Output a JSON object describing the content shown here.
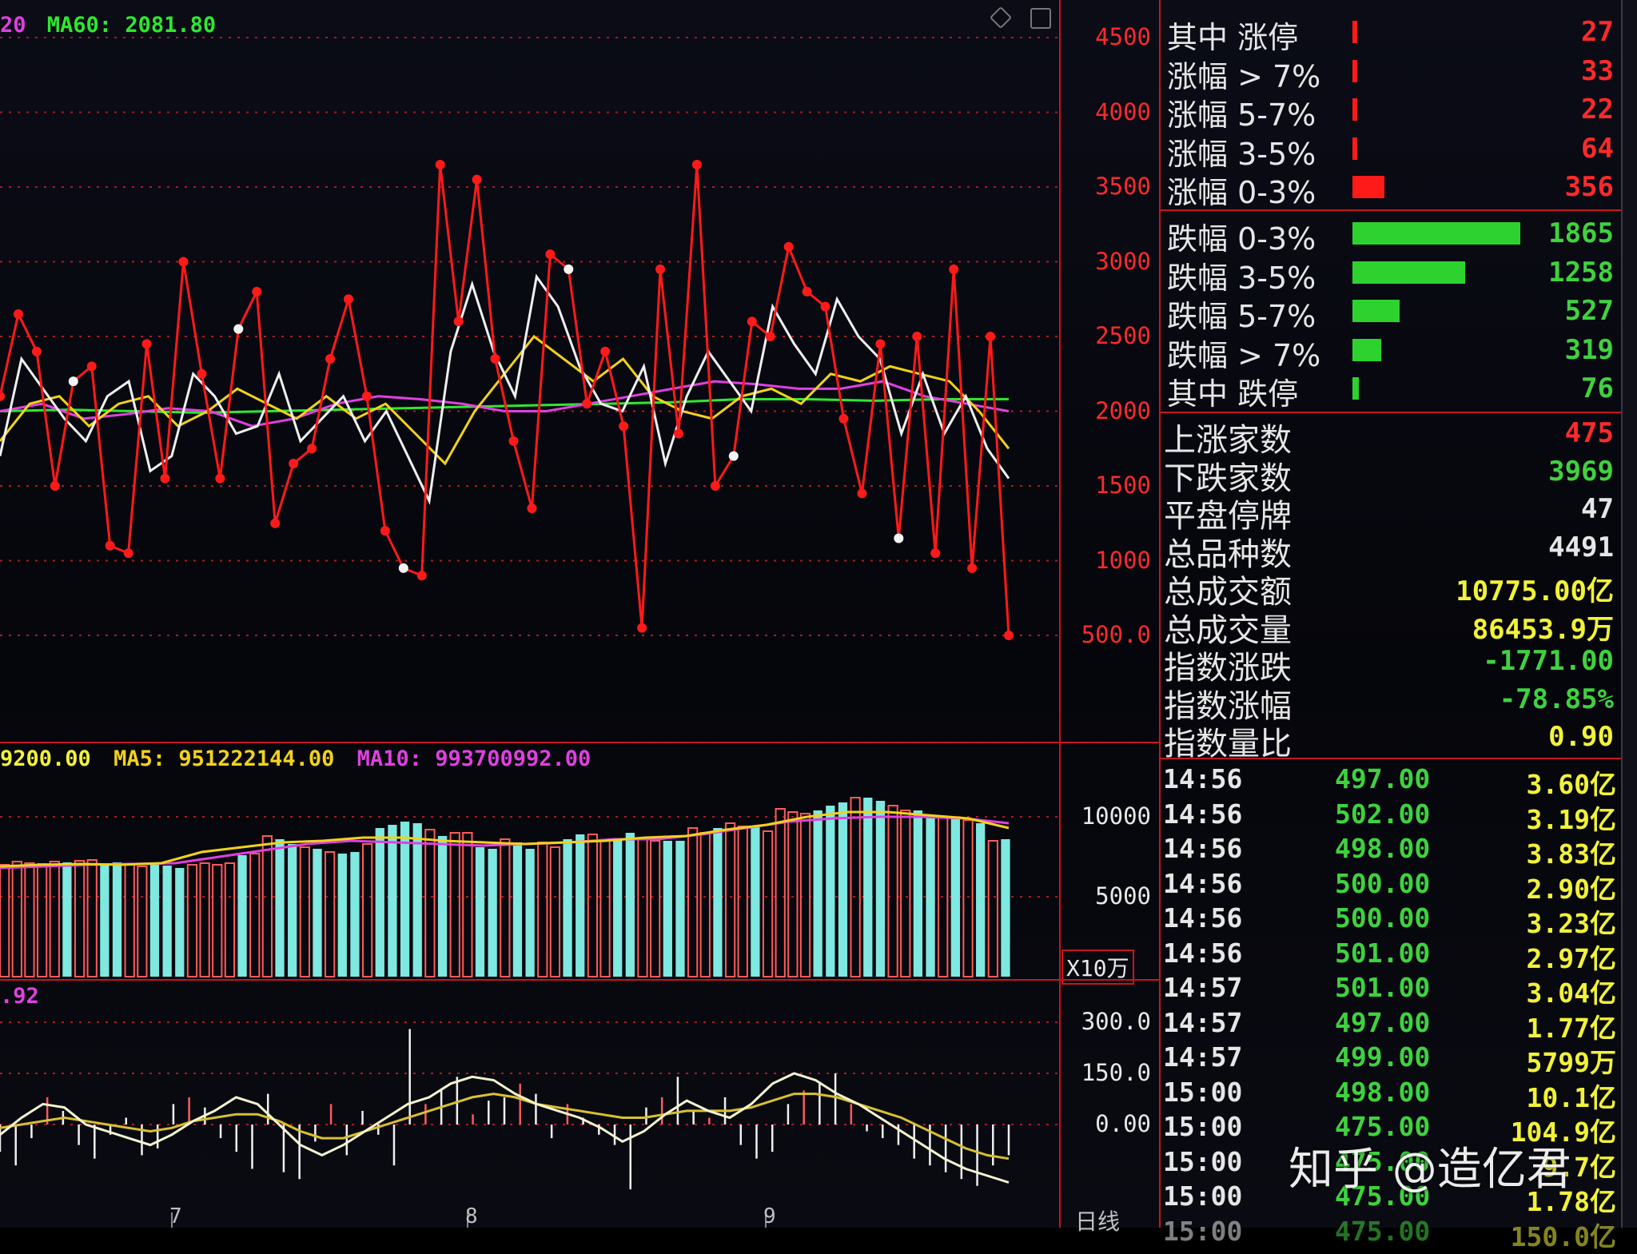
{
  "main_chart": {
    "legend": {
      "ma20_partial": "20",
      "ma60": "MA60: 2081.80"
    },
    "y_axis_labels": [
      "4500",
      "4000",
      "3500",
      "3000",
      "2500",
      "2000",
      "1500",
      "1000",
      "500.0"
    ],
    "y_axis_values": [
      4500,
      4000,
      3500,
      3000,
      2500,
      2000,
      1500,
      1000,
      500
    ],
    "colors": {
      "price": "#ff1a1a",
      "ma5": "#f0f0f0",
      "ma10": "#f2d21a",
      "ma20": "#e040e0",
      "ma60": "#2ee82e"
    },
    "price_series": [
      2100,
      2650,
      2400,
      1500,
      2200,
      2300,
      1100,
      1050,
      2450,
      1550,
      3000,
      2250,
      1550,
      2550,
      2800,
      1250,
      1650,
      1750,
      2350,
      2750,
      2100,
      1200,
      950,
      900,
      3650,
      2600,
      3550,
      2350,
      1800,
      1350,
      3050,
      2950,
      2050,
      2400,
      1900,
      550,
      2950,
      1850,
      3650,
      1500,
      1700,
      2600,
      2500,
      3100,
      2800,
      2700,
      1950,
      1450,
      2450,
      1150,
      2500,
      1050,
      2950,
      950,
      2500,
      500
    ],
    "ma5_series": [
      1700,
      2350,
      2150,
      1950,
      1800,
      2100,
      2200,
      1600,
      1700,
      2250,
      2100,
      1850,
      1900,
      2250,
      1800,
      1950,
      2100,
      1800,
      2000,
      1700,
      1400,
      2400,
      2850,
      2400,
      2100,
      2900,
      2700,
      2300,
      2050,
      2000,
      2300,
      1650,
      2100,
      2400,
      2200,
      2000,
      2700,
      2450,
      2250,
      2750,
      2500,
      2350,
      1850,
      2250,
      1850,
      2100,
      1750,
      1550
    ],
    "ma10_series": [
      1800,
      2050,
      2100,
      1900,
      2050,
      2100,
      1900,
      2000,
      2150,
      2050,
      1950,
      2100,
      1950,
      2050,
      1850,
      1650,
      2000,
      2250,
      2500,
      2350,
      2200,
      2350,
      2100,
      2000,
      1950,
      2100,
      2150,
      2050,
      2250,
      2200,
      2300,
      2250,
      2200,
      2000,
      1750
    ],
    "ma20_series": [
      2000,
      2050,
      1950,
      1980,
      2020,
      2000,
      1900,
      1950,
      2050,
      2100,
      2080,
      2050,
      2000,
      2000,
      2050,
      2100,
      2150,
      2200,
      2180,
      2150,
      2150,
      2200,
      2100,
      2050,
      2000
    ],
    "ma60_series": [
      2000,
      2010,
      2000,
      1990,
      2000,
      2010,
      2020,
      2030,
      2040,
      2050,
      2060,
      2080,
      2080,
      2070,
      2080,
      2081
    ]
  },
  "volume_chart": {
    "legend": {
      "vol_partial": "9200.00",
      "ma5": "MA5: 951222144.00",
      "ma10": "MA10: 993700992.00"
    },
    "y_axis_labels": [
      "10000",
      "5000"
    ],
    "y_axis_values": [
      10000,
      5000
    ],
    "unit": "X10万",
    "colors": {
      "up": "#ff5a5a",
      "down": "#7fe8e0"
    },
    "bars": [
      7000,
      7200,
      7100,
      7050,
      7200,
      7150,
      7250,
      7300,
      7100,
      7150,
      7000,
      6900,
      7000,
      6950,
      6800,
      7000,
      7100,
      7000,
      7100,
      7600,
      7700,
      8800,
      8600,
      8300,
      8100,
      8000,
      7800,
      7700,
      7800,
      8300,
      9300,
      9500,
      9700,
      9600,
      9200,
      8800,
      9000,
      9000,
      8100,
      8000,
      8600,
      8400,
      8000,
      8400,
      8100,
      8600,
      8900,
      8900,
      8500,
      8600,
      9000,
      8600,
      8500,
      8500,
      8500,
      9300,
      9000,
      9300,
      9600,
      9400,
      9400,
      9100,
      10500,
      10300,
      10200,
      10400,
      10700,
      10900,
      11200,
      11200,
      11000,
      10700,
      10400,
      10400,
      10100,
      10000,
      10000,
      9800,
      9600,
      8500,
      8600
    ],
    "bar_up": [
      true,
      true,
      true,
      true,
      true,
      false,
      true,
      true,
      false,
      false,
      true,
      true,
      false,
      false,
      false,
      true,
      true,
      true,
      true,
      false,
      true,
      true,
      false,
      false,
      true,
      false,
      true,
      false,
      false,
      true,
      false,
      false,
      false,
      false,
      true,
      false,
      true,
      true,
      false,
      false,
      true,
      false,
      false,
      true,
      true,
      false,
      false,
      true,
      true,
      false,
      false,
      true,
      true,
      false,
      false,
      true,
      true,
      false,
      true,
      true,
      false,
      true,
      true,
      true,
      true,
      false,
      false,
      false,
      true,
      false,
      false,
      true,
      true,
      false,
      false,
      true,
      false,
      true,
      false,
      true,
      false
    ],
    "ma5_series": [
      6900,
      7000,
      7050,
      7000,
      7100,
      7800,
      8100,
      8400,
      8500,
      8700,
      8700,
      8500,
      8400,
      8300,
      8400,
      8500,
      8700,
      8800,
      9200,
      9500,
      10000,
      10300,
      10300,
      10100,
      9900,
      9300
    ],
    "ma10_series": [
      6800,
      6900,
      7000,
      7050,
      7100,
      7500,
      7900,
      8300,
      8500,
      8400,
      8300,
      8200,
      8300,
      8400,
      8600,
      8600,
      8900,
      9300,
      9700,
      9900,
      10000,
      10000,
      9900,
      9600
    ]
  },
  "indicator_chart": {
    "legend": {
      "partial": ".92"
    },
    "y_axis_labels": [
      "300.0",
      "150.0",
      "0.00"
    ],
    "y_axis_values": [
      300,
      150,
      0
    ],
    "colors": {
      "hist": "#f0f0f0",
      "hist_up": "#ff5a5a",
      "line_a": "#f4f4d0",
      "line_b": "#d8c030"
    },
    "hist": [
      -80,
      -120,
      -40,
      80,
      40,
      -60,
      -100,
      -30,
      20,
      -90,
      -70,
      60,
      80,
      50,
      -40,
      -80,
      -130,
      90,
      -140,
      -160,
      -50,
      60,
      -90,
      40,
      -30,
      -120,
      280,
      60,
      100,
      140,
      30,
      70,
      80,
      120,
      90,
      -40,
      60,
      20,
      -30,
      -60,
      -190,
      50,
      80,
      140,
      40,
      20,
      80,
      -60,
      -100,
      -80,
      60,
      100,
      120,
      150,
      60,
      -20,
      -40,
      -60,
      -100,
      -120,
      -140,
      -160,
      -180,
      -120,
      -90
    ],
    "line_a": [
      -30,
      20,
      60,
      50,
      0,
      -20,
      -40,
      -60,
      -30,
      10,
      40,
      80,
      60,
      0,
      -60,
      -90,
      -60,
      -20,
      20,
      60,
      80,
      120,
      140,
      130,
      90,
      60,
      40,
      20,
      -10,
      -50,
      -20,
      30,
      70,
      40,
      20,
      60,
      120,
      150,
      130,
      90,
      60,
      20,
      -20,
      -60,
      -100,
      -130,
      -150,
      -170
    ],
    "line_b": [
      -10,
      0,
      10,
      20,
      10,
      0,
      -10,
      -20,
      -10,
      10,
      20,
      30,
      30,
      10,
      -20,
      -40,
      -40,
      -20,
      0,
      20,
      40,
      60,
      80,
      90,
      80,
      60,
      50,
      40,
      30,
      20,
      20,
      30,
      40,
      40,
      40,
      50,
      70,
      90,
      90,
      80,
      60,
      40,
      20,
      -10,
      -40,
      -70,
      -90,
      -100
    ],
    "x_bottom_labels": [
      "7",
      "8",
      "9",
      "日线"
    ]
  },
  "top_controls": {
    "icons": [
      "diamond-icon",
      "window-icon"
    ]
  },
  "stats_panel": {
    "rise_rows": [
      {
        "label": "其中 涨停",
        "value": "27",
        "ratio": 0.004
      },
      {
        "label": "涨幅 > 7%",
        "value": "33",
        "ratio": 0.005
      },
      {
        "label": "涨幅 5-7%",
        "value": "22",
        "ratio": 0.004
      },
      {
        "label": "涨幅 3-5%",
        "value": "64",
        "ratio": 0.01
      },
      {
        "label": "涨幅 0-3%",
        "value": "356",
        "ratio": 0.19
      }
    ],
    "fall_rows": [
      {
        "label": "跌幅 0-3%",
        "value": "1865",
        "ratio": 1.0
      },
      {
        "label": "跌幅 3-5%",
        "value": "1258",
        "ratio": 0.67
      },
      {
        "label": "跌幅 5-7%",
        "value": "527",
        "ratio": 0.28
      },
      {
        "label": "跌幅 > 7%",
        "value": "319",
        "ratio": 0.17
      },
      {
        "label": "其中 跌停",
        "value": "76",
        "ratio": 0.04
      }
    ],
    "summary_rows": [
      {
        "label": "上涨家数",
        "value": "475",
        "color": "#ff2a2a"
      },
      {
        "label": "下跌家数",
        "value": "3969",
        "color": "#3fd23f"
      },
      {
        "label": "平盘停牌",
        "value": "47",
        "color": "#e6e6e6"
      },
      {
        "label": "总品种数",
        "value": "4491",
        "color": "#e6e6e6"
      },
      {
        "label": "总成交额",
        "value": "10775.00亿",
        "color": "#f2f23a"
      },
      {
        "label": "总成交量",
        "value": "86453.9万",
        "color": "#f2f23a"
      },
      {
        "label": "指数涨跌",
        "value": "-1771.00",
        "color": "#3fd23f"
      },
      {
        "label": "指数涨幅",
        "value": "-78.85%",
        "color": "#3fd23f"
      },
      {
        "label": "指数量比",
        "value": "0.90",
        "color": "#f2f23a"
      }
    ]
  },
  "ticks": [
    {
      "time": "14:56",
      "price": "497.00",
      "vol": "3.60亿"
    },
    {
      "time": "14:56",
      "price": "502.00",
      "vol": "3.19亿"
    },
    {
      "time": "14:56",
      "price": "498.00",
      "vol": "3.83亿"
    },
    {
      "time": "14:56",
      "price": "500.00",
      "vol": "2.90亿"
    },
    {
      "time": "14:56",
      "price": "500.00",
      "vol": "3.23亿"
    },
    {
      "time": "14:56",
      "price": "501.00",
      "vol": "2.97亿"
    },
    {
      "time": "14:57",
      "price": "501.00",
      "vol": "3.04亿"
    },
    {
      "time": "14:57",
      "price": "497.00",
      "vol": "1.77亿"
    },
    {
      "time": "14:57",
      "price": "499.00",
      "vol": "5799万"
    },
    {
      "time": "15:00",
      "price": "498.00",
      "vol": "10.1亿"
    },
    {
      "time": "15:00",
      "price": "475.00",
      "vol": "104.9亿"
    },
    {
      "time": "15:00",
      "price": "475.00",
      "vol": "9.7亿"
    },
    {
      "time": "15:00",
      "price": "475.00",
      "vol": "1.78亿"
    },
    {
      "time": "15:00",
      "price": "475.00",
      "vol": "150.0亿"
    }
  ],
  "watermark": "知乎 @造亿君"
}
